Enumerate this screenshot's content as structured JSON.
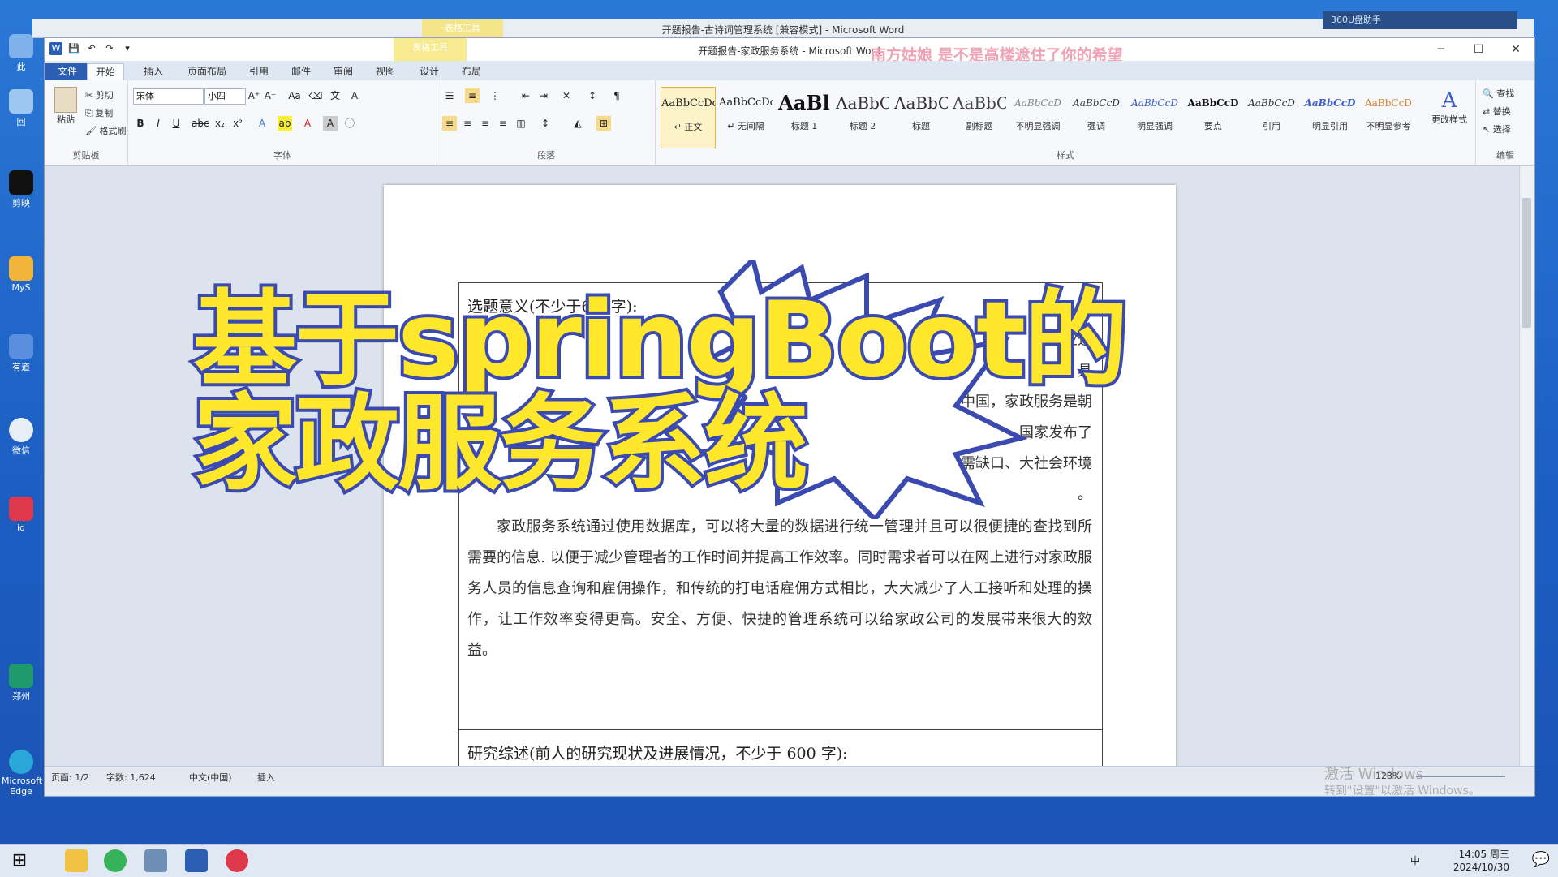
{
  "back_window": {
    "title": "开题报告-古诗词管理系统 [兼容模式] - Microsoft Word",
    "tooltab": "表格工具",
    "badge": "360U盘助手"
  },
  "window": {
    "title": "开题报告-家政服务系统 - Microsoft Word",
    "tooltab": "表格工具",
    "lyrics": "南方姑娘 是不是高楼遮住了你的希望",
    "controls": {
      "minimize": "─",
      "maximize": "☐",
      "close": "✕"
    }
  },
  "tabs": [
    "文件",
    "开始",
    "插入",
    "页面布局",
    "引用",
    "邮件",
    "审阅",
    "视图",
    "设计",
    "布局"
  ],
  "ribbon": {
    "clipboard": {
      "paste": "粘贴",
      "cut": "剪切",
      "copy": "复制",
      "format_painter": "格式刷",
      "label": "剪贴板"
    },
    "font": {
      "name": "宋体",
      "size": "小四",
      "label": "字体"
    },
    "paragraph": {
      "label": "段落"
    },
    "styles": {
      "label": "样式",
      "items": [
        {
          "sample": "AaBbCcDc",
          "name": "↵ 正文"
        },
        {
          "sample": "AaBbCcDc",
          "name": "↵ 无间隔"
        },
        {
          "sample": "AaBl",
          "name": "标题 1"
        },
        {
          "sample": "AaBbC",
          "name": "标题 2"
        },
        {
          "sample": "AaBbC",
          "name": "标题"
        },
        {
          "sample": "AaBbC",
          "name": "副标题"
        },
        {
          "sample": "AaBbCcD",
          "name": "不明显强调"
        },
        {
          "sample": "AaBbCcD",
          "name": "强调"
        },
        {
          "sample": "AaBbCcD",
          "name": "明显强调"
        },
        {
          "sample": "AaBbCcD",
          "name": "要点"
        },
        {
          "sample": "AaBbCcD",
          "name": "引用"
        },
        {
          "sample": "AaBbCcD",
          "name": "明显引用"
        },
        {
          "sample": "AaBbCcD",
          "name": "不明显参考"
        }
      ],
      "change_styles": "更改样式"
    },
    "editing": {
      "find": "查找",
      "replace": "替换",
      "select": "选择",
      "label": "编辑"
    }
  },
  "document": {
    "cell1_heading": "选题意义(不少于600字):",
    "para1_lines": [
      "行业进",
      "业，具",
      "瓶颈之一。此外，在中国，家政服务是朝",
      "服务的需求量呈井喷态势，国家发布了",
      "国家政策、市场供需缺口、大社会环境",
      "。"
    ],
    "para2": "家政服务系统通过使用数据库，可以将大量的数据进行统一管理并且可以很便捷的查找到所需要的信息. 以便于减少管理者的工作时间并提高工作效率。同时需求者可以在网上进行对家政服务人员的信息查询和雇佣操作，和传统的打电话雇佣方式相比，大大减少了人工接听和处理的操作，让工作效率变得更高。安全、方便、快捷的管理系统可以给家政公司的发展带来很大的效益。",
    "cell2_heading": "研究综述(前人的研究现状及进展情况，不少于 600 字):"
  },
  "overlay": {
    "line1": "基于springBoot的",
    "line2": "家政服务系统"
  },
  "status": {
    "page": "页面: 1/2",
    "words": "字数: 1,624",
    "language": "中文(中国)",
    "mode": "插入",
    "zoom": "123%"
  },
  "watermark": {
    "line1": "激活 Windows",
    "line2": "转到\"设置\"以激活 Windows。"
  },
  "desktop_icons": [
    "此",
    "回",
    "剪映",
    "MyS",
    "有道",
    "微信",
    "id",
    "郑州",
    "Microsoft Edge"
  ],
  "taskbar": {
    "time": "14:05 周三",
    "date": "2024/10/30",
    "ime": "中"
  }
}
